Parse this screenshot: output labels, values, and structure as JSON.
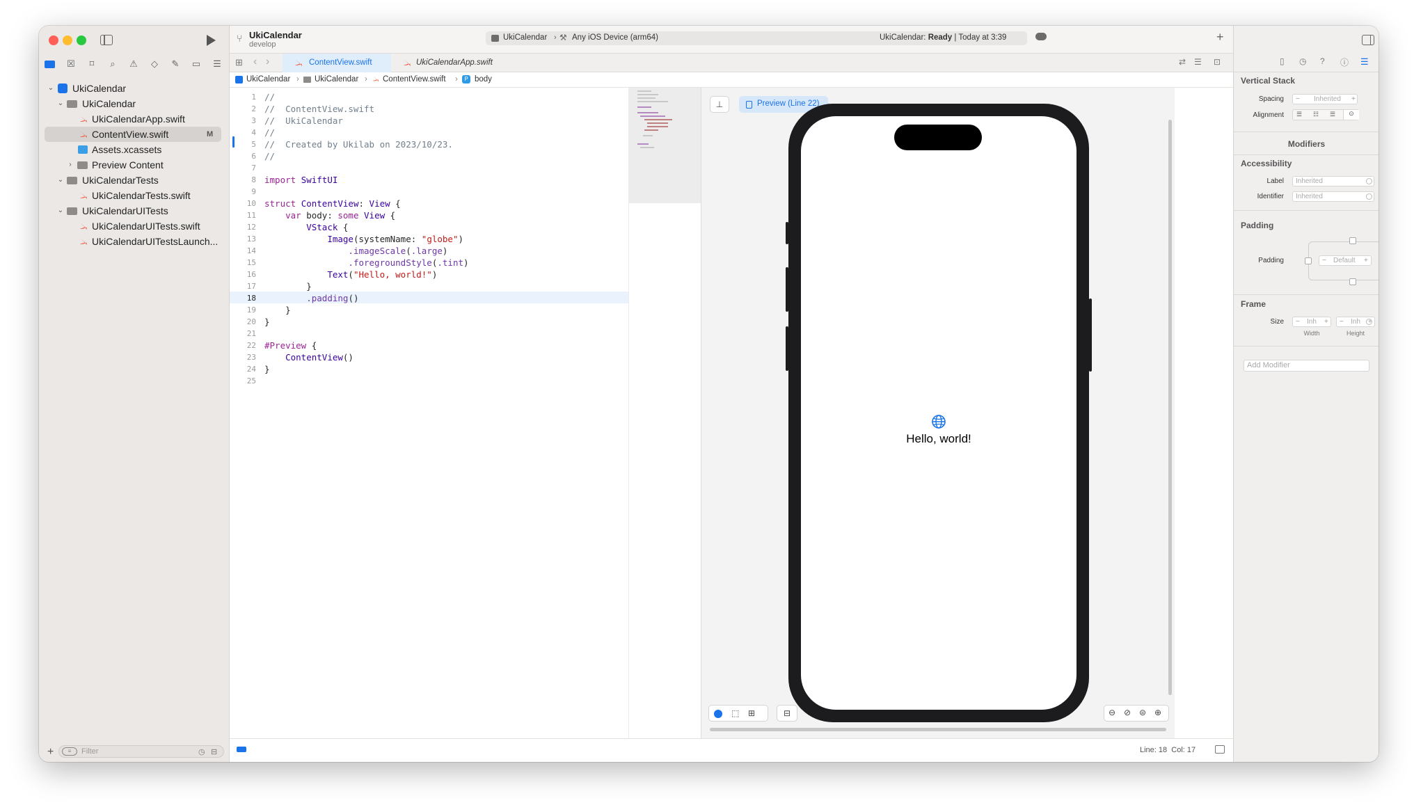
{
  "window": {
    "project_title": "UkiCalendar",
    "branch": "develop"
  },
  "toolbar": {
    "scheme": "UkiCalendar",
    "destination": "Any iOS Device (arm64)",
    "status_prefix": "UkiCalendar:",
    "status_state": "Ready",
    "status_time": "| Today at 3:39"
  },
  "navigator": {
    "items": [
      {
        "label": "UkiCalendar",
        "kind": "project"
      },
      {
        "label": "UkiCalendar",
        "kind": "folder"
      },
      {
        "label": "UkiCalendarApp.swift",
        "kind": "swift"
      },
      {
        "label": "ContentView.swift",
        "kind": "swift",
        "badge": "M",
        "selected": true
      },
      {
        "label": "Assets.xcassets",
        "kind": "assets"
      },
      {
        "label": "Preview Content",
        "kind": "folder"
      },
      {
        "label": "UkiCalendarTests",
        "kind": "folder"
      },
      {
        "label": "UkiCalendarTests.swift",
        "kind": "swift"
      },
      {
        "label": "UkiCalendarUITests",
        "kind": "folder"
      },
      {
        "label": "UkiCalendarUITests.swift",
        "kind": "swift"
      },
      {
        "label": "UkiCalendarUITestsLaunch...",
        "kind": "swift"
      }
    ],
    "filter_placeholder": "Filter"
  },
  "tabs": [
    {
      "label": "ContentView.swift",
      "active": true
    },
    {
      "label": "UkiCalendarApp.swift",
      "active": false
    }
  ],
  "jumpbar": {
    "crumbs": [
      "UkiCalendar",
      "UkiCalendar",
      "ContentView.swift",
      "body"
    ]
  },
  "code": {
    "current_line": 18,
    "lines": [
      "//",
      "//  ContentView.swift",
      "//  UkiCalendar",
      "//",
      "//  Created by Ukilab on 2023/10/23.",
      "//",
      "",
      "import SwiftUI",
      "",
      "struct ContentView: View {",
      "    var body: some View {",
      "        VStack {",
      "            Image(systemName: \"globe\")",
      "                .imageScale(.large)",
      "                .foregroundStyle(.tint)",
      "            Text(\"Hello, world!\")",
      "        }",
      "        .padding()",
      "    }",
      "}",
      "",
      "#Preview {",
      "    ContentView()",
      "}",
      ""
    ],
    "line_numbers": [
      "1",
      "2",
      "3",
      "4",
      "5",
      "6",
      "7",
      "8",
      "9",
      "10",
      "11",
      "12",
      "13",
      "14",
      "15",
      "16",
      "17",
      "18",
      "19",
      "20",
      "21",
      "22",
      "23",
      "24",
      "25"
    ]
  },
  "preview": {
    "badge": "Preview (Line 22)",
    "text": "Hello, world!"
  },
  "statusbar": {
    "position": "Line: 18  Col: 17"
  },
  "inspector": {
    "section_title": "Vertical Stack",
    "spacing_label": "Spacing",
    "spacing_value": "Inherited",
    "alignment_label": "Alignment",
    "modifiers_title": "Modifiers",
    "accessibility_title": "Accessibility",
    "label_label": "Label",
    "label_value": "Inherited",
    "identifier_label": "Identifier",
    "identifier_value": "Inherited",
    "padding_title": "Padding",
    "padding_label": "Padding",
    "padding_value": "Default",
    "frame_title": "Frame",
    "size_label": "Size",
    "width_value": "Inh",
    "height_value": "Inh",
    "width_caption": "Width",
    "height_caption": "Height",
    "add_modifier_placeholder": "Add Modifier"
  },
  "colors": {
    "accent": "#1a73e8",
    "sidebar": "#ebe8e6",
    "swift_orange": "#f05138"
  }
}
